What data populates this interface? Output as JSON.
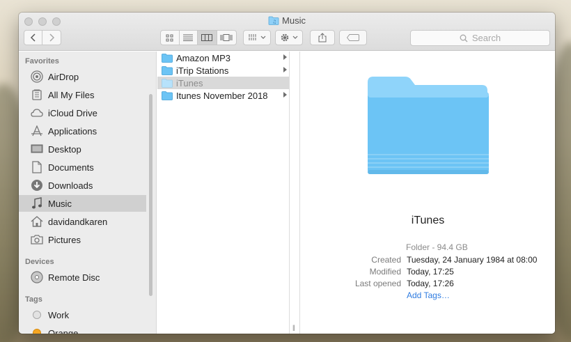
{
  "window": {
    "title": "Music"
  },
  "toolbar": {
    "search_placeholder": "Search"
  },
  "sidebar": {
    "sections": [
      {
        "header": "Favorites"
      },
      {
        "header": "Devices"
      },
      {
        "header": "Tags"
      }
    ],
    "favorites": [
      {
        "label": "AirDrop",
        "icon": "airdrop-icon"
      },
      {
        "label": "All My Files",
        "icon": "all-my-files-icon"
      },
      {
        "label": "iCloud Drive",
        "icon": "cloud-icon"
      },
      {
        "label": "Applications",
        "icon": "applications-icon"
      },
      {
        "label": "Desktop",
        "icon": "desktop-icon"
      },
      {
        "label": "Documents",
        "icon": "documents-icon"
      },
      {
        "label": "Downloads",
        "icon": "downloads-icon"
      },
      {
        "label": "Music",
        "icon": "music-icon",
        "selected": true
      },
      {
        "label": "davidandkaren",
        "icon": "home-icon"
      },
      {
        "label": "Pictures",
        "icon": "camera-icon"
      }
    ],
    "devices": [
      {
        "label": "Remote Disc",
        "icon": "disc-icon"
      }
    ],
    "tags": [
      {
        "label": "Work",
        "color": "#d8d8d8"
      },
      {
        "label": "Orange",
        "color": "#f5a623"
      }
    ]
  },
  "column1": {
    "items": [
      {
        "label": "Amazon MP3",
        "has_children": true
      },
      {
        "label": "iTrip Stations",
        "has_children": true
      },
      {
        "label": "iTunes",
        "has_children": false,
        "selected": true
      },
      {
        "label": "Itunes November 2018",
        "has_children": true
      }
    ]
  },
  "preview": {
    "name": "iTunes",
    "kind": "Folder - 94.4 GB",
    "created_label": "Created",
    "created_value": "Tuesday, 24 January 1984 at 08:00",
    "modified_label": "Modified",
    "modified_value": "Today, 17:25",
    "last_opened_label": "Last opened",
    "last_opened_value": "Today, 17:26",
    "add_tags": "Add Tags…"
  },
  "colors": {
    "folder": "#6cc4f5",
    "link": "#2f7ce0",
    "selection": "#d0d0d0"
  }
}
